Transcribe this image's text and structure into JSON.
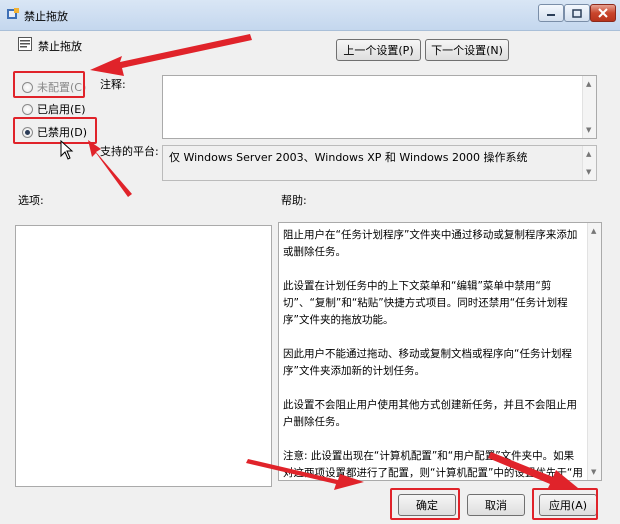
{
  "window": {
    "title": "禁止拖放",
    "policy_name": "禁止拖放"
  },
  "nav": {
    "prev_label": "上一个设置(P)",
    "next_label": "下一个设置(N)"
  },
  "state": {
    "options": [
      {
        "label": "未配置(C)",
        "selected": false
      },
      {
        "label": "已启用(E)",
        "selected": false
      },
      {
        "label": "已禁用(D)",
        "selected": true
      }
    ]
  },
  "labels": {
    "comment": "注释:",
    "platform": "支持的平台:",
    "options": "选项:",
    "help": "帮助:"
  },
  "platform_text": "仅 Windows Server 2003、Windows XP 和 Windows 2000 操作系统",
  "comment_value": "",
  "help": {
    "paragraphs": [
      "阻止用户在“任务计划程序”文件夹中通过移动或复制程序来添加或删除任务。",
      "此设置在计划任务中的上下文菜单和“编辑”菜单中禁用“剪切”、“复制”和“粘贴”快捷方式项目。同时还禁用“任务计划程序”文件夹的拖放功能。",
      "因此用户不能通过拖动、移动或复制文档或程序向“任务计划程序”文件夹添加新的计划任务。",
      "此设置不会阻止用户使用其他方式创建新任务，并且不会阻止用户删除任务。",
      "注意: 此设置出现在“计算机配置”和“用户配置”文件夹中。如果对这两项设置都进行了配置，则“计算机配置”中的设置优先于“用户配置”中的设置。"
    ]
  },
  "footer": {
    "ok_label": "确定",
    "cancel_label": "取消",
    "apply_label": "应用(A)"
  },
  "colors": {
    "annotation": "#e0232a",
    "titlebar": "#c4d7ee"
  }
}
